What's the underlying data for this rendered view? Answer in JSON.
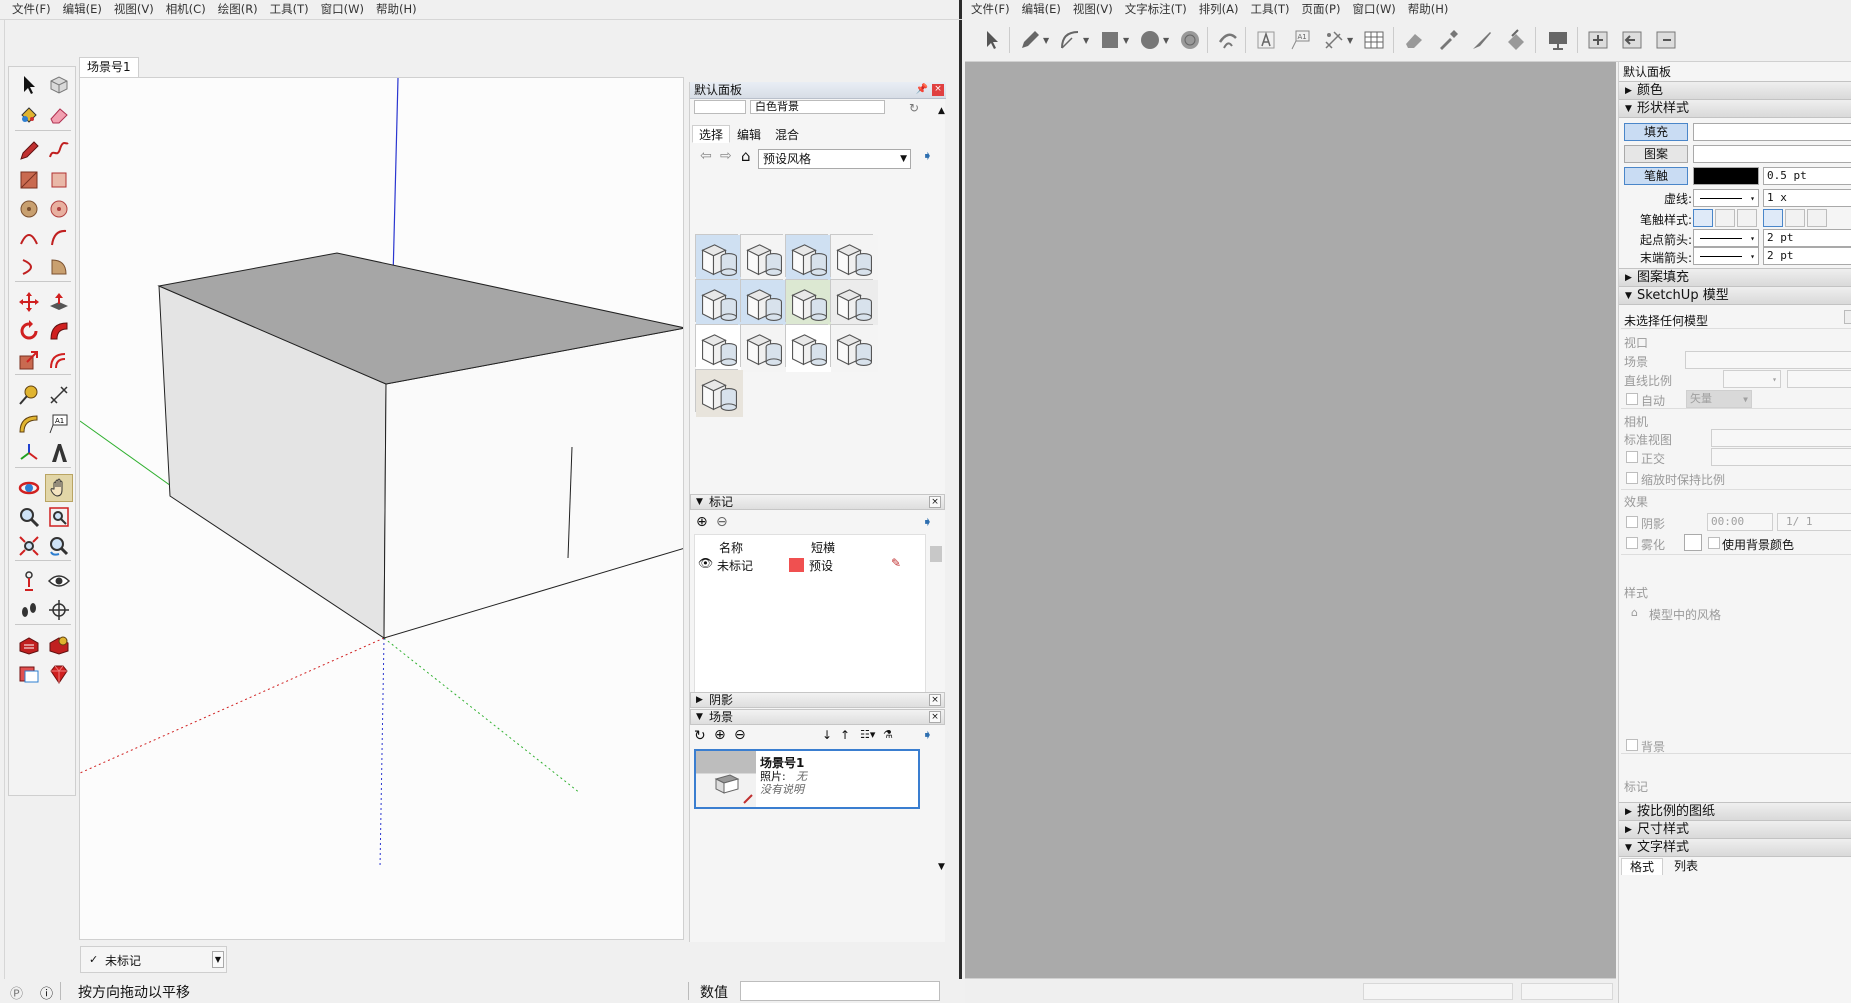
{
  "left_app": {
    "menu": [
      "文件(F)",
      "编辑(E)",
      "视图(V)",
      "相机(C)",
      "绘图(R)",
      "工具(T)",
      "窗口(W)",
      "帮助(H)"
    ],
    "scene_tab": "场景号1",
    "tag_selector": "未标记",
    "status_message": "按方向拖动以平移",
    "measurement_label": "数值",
    "measurement_value": ""
  },
  "default_panel": {
    "title": "默认面板",
    "background_preview_label": "白色背景",
    "tabs": [
      "选择",
      "编辑",
      "混合"
    ],
    "active_tab": "选择",
    "style_collection": "预设风格",
    "tags_section": {
      "title": "标记",
      "columns": [
        "名称",
        "短横"
      ],
      "rows": [
        {
          "name": "未标记",
          "color": "#f05050",
          "dash": "预设"
        }
      ]
    },
    "shadows_section": {
      "title": "阴影"
    },
    "scenes_section": {
      "title": "场景",
      "scene_name": "场景号1",
      "photo_label": "照片:",
      "photo_value": "无",
      "description": "没有说明"
    }
  },
  "right_app": {
    "menu": [
      "文件(F)",
      "编辑(E)",
      "视图(V)",
      "文字标注(T)",
      "排列(A)",
      "工具(T)",
      "页面(P)",
      "窗口(W)",
      "帮助(H)"
    ],
    "panel_title": "默认面板",
    "sections": {
      "color": "颜色",
      "shape_style": "形状样式",
      "pattern_fill": "图案填充",
      "sketchup_model": "SketchUp 模型",
      "scaled_drawing": "按比例的图纸",
      "dimension_style": "尺寸样式",
      "text_style": "文字样式"
    },
    "shape_style": {
      "fill_btn": "填充",
      "pattern_btn": "图案",
      "stroke_btn": "笔触",
      "stroke_width": "0.5 pt",
      "dash_label": "虚线:",
      "dash_scale": "1 x",
      "stroke_style_label": "笔触样式:",
      "start_arrow_label": "起点箭头:",
      "start_arrow_size": "2 pt",
      "end_arrow_label": "末端箭头:",
      "end_arrow_size": "2 pt"
    },
    "sketchup_model": {
      "status": "未选择任何模型",
      "viewport": "视口",
      "scene": "场景",
      "line_scale": "直线比例",
      "auto": "自动",
      "vector": "矢量",
      "camera": "相机",
      "standard_view": "标准视图",
      "ortho": "正交",
      "keep_ratio": "缩放时保持比例",
      "effects": "效果",
      "shadows": "阴影",
      "shadow_time": "00:00",
      "shadow_date": "1/ 1",
      "fog": "雾化",
      "use_bg_color": "使用背景颜色",
      "styles": "样式",
      "model_styles": "模型中的风格",
      "background": "背景",
      "tags": "标记"
    },
    "text_style_tabs": [
      "格式",
      "列表"
    ]
  }
}
